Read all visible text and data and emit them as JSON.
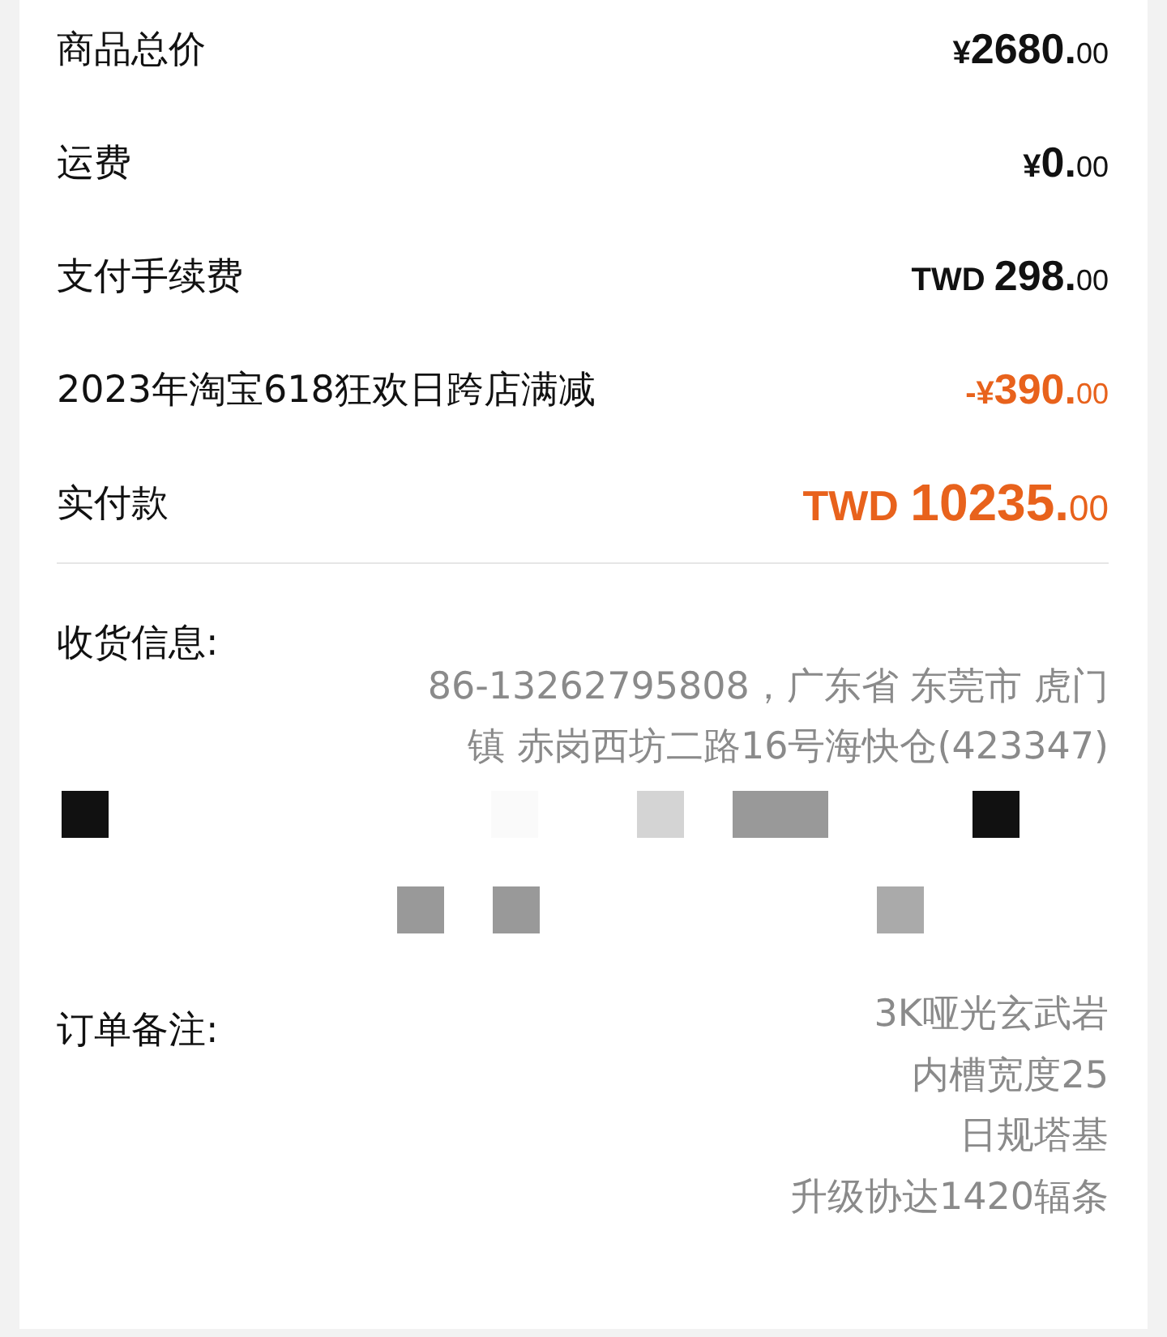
{
  "price_rows": [
    {
      "label": "商品总价",
      "kind": "normal",
      "currency": "¥",
      "amount": "2680.",
      "cents": "00"
    },
    {
      "label": "运费",
      "kind": "normal",
      "currency": "¥",
      "amount": "0.",
      "cents": "00"
    },
    {
      "label": "支付手续费",
      "kind": "normal",
      "currency": "TWD ",
      "amount": "298.",
      "cents": "00"
    },
    {
      "label": "2023年淘宝618狂欢日跨店满减",
      "kind": "discount",
      "currency": "-¥",
      "amount": "390.",
      "cents": "00"
    },
    {
      "label": "实付款",
      "kind": "total",
      "currency": "TWD ",
      "amount": "10235.",
      "cents": "00"
    }
  ],
  "shipping": {
    "label": "收货信息:",
    "lines": [
      "86-13262795808，广东省 东莞市 虎门",
      "镇 赤岗西坊二路16号海快仓(423347)"
    ]
  },
  "note": {
    "label": "订单备注:",
    "lines": [
      "3K哑光玄武岩",
      "内槽宽度25",
      "日规塔基",
      "升级协达1420辐条"
    ]
  }
}
